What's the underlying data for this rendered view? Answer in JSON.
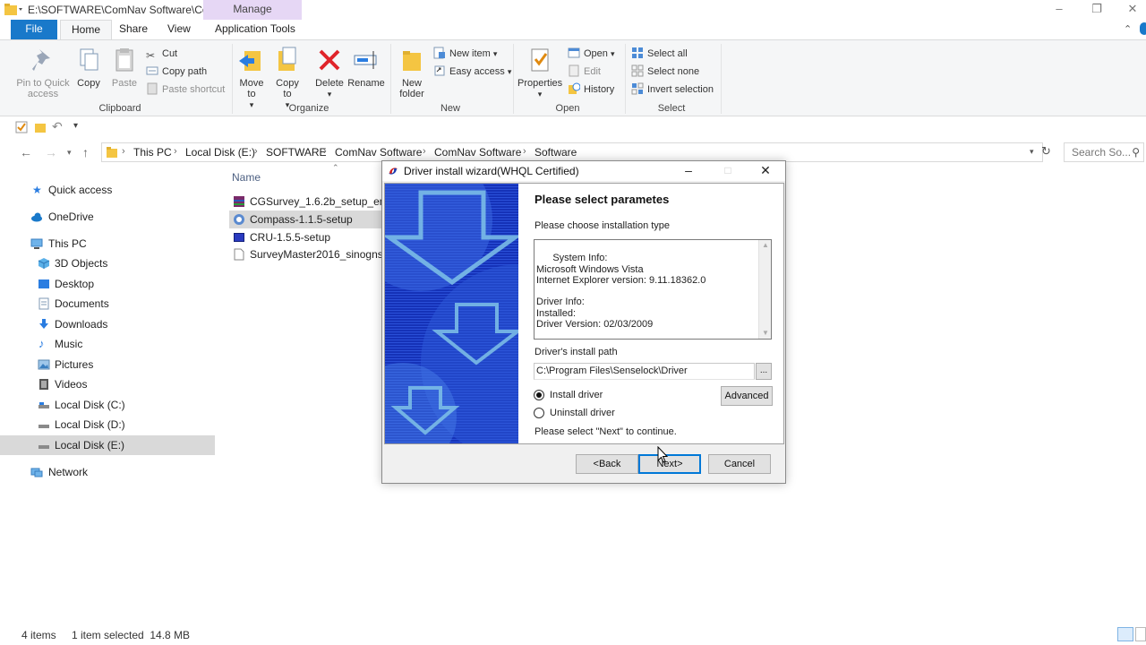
{
  "window": {
    "title": "E:\\SOFTWARE\\ComNav Software\\Co...",
    "manage_tab": "Manage"
  },
  "tabs": [
    "File",
    "Home",
    "Share",
    "View",
    "Application Tools"
  ],
  "ribbon": {
    "clipboard": {
      "label": "Clipboard",
      "pin": "Pin to Quick access",
      "copy": "Copy",
      "paste": "Paste",
      "cut": "Cut",
      "copy_path": "Copy path",
      "paste_shortcut": "Paste shortcut"
    },
    "organize": {
      "label": "Organize",
      "move_to": "Move to",
      "copy_to": "Copy to",
      "delete": "Delete",
      "rename": "Rename"
    },
    "new": {
      "label": "New",
      "new_folder": "New folder",
      "new_item": "New item",
      "easy_access": "Easy access"
    },
    "open": {
      "label": "Open",
      "properties": "Properties",
      "open": "Open",
      "edit": "Edit",
      "history": "History"
    },
    "select": {
      "label": "Select",
      "select_all": "Select all",
      "select_none": "Select none",
      "invert": "Invert selection"
    }
  },
  "breadcrumb": [
    "This PC",
    "Local Disk (E:)",
    "SOFTWARE",
    "ComNav Software",
    "ComNav Software",
    "Software"
  ],
  "search": {
    "placeholder": "Search So..."
  },
  "nav": [
    {
      "label": "Quick access",
      "icon": "star-icon"
    },
    {
      "label": "OneDrive",
      "icon": "cloud-icon"
    },
    {
      "label": "This PC",
      "icon": "monitor-icon"
    },
    {
      "label": "3D Objects",
      "icon": "cube-icon"
    },
    {
      "label": "Desktop",
      "icon": "desktop-icon"
    },
    {
      "label": "Documents",
      "icon": "document-icon"
    },
    {
      "label": "Downloads",
      "icon": "download-icon"
    },
    {
      "label": "Music",
      "icon": "music-icon"
    },
    {
      "label": "Pictures",
      "icon": "picture-icon"
    },
    {
      "label": "Videos",
      "icon": "video-icon"
    },
    {
      "label": "Local Disk (C:)",
      "icon": "drive-icon"
    },
    {
      "label": "Local Disk (D:)",
      "icon": "drive-icon"
    },
    {
      "label": "Local Disk (E:)",
      "icon": "drive-icon"
    },
    {
      "label": "Network",
      "icon": "network-icon"
    }
  ],
  "filelist": {
    "column_name": "Name",
    "files": [
      {
        "name": "CGSurvey_1.6.2b_setup_en",
        "icon": "archive-icon"
      },
      {
        "name": "Compass-1.1.5-setup",
        "icon": "setup-icon"
      },
      {
        "name": "CRU-1.5.5-setup",
        "icon": "setup-icon"
      },
      {
        "name": "SurveyMaster2016_sinognss-1",
        "icon": "file-icon"
      }
    ]
  },
  "status": {
    "items": "4 items",
    "selected": "1 item selected  14.8 MB"
  },
  "dialog": {
    "title": "Driver install wizard(WHQL Certified)",
    "heading": "Please select parametes",
    "choose_label": "Please choose installation type",
    "info_text": "System Info:\nMicrosoft Windows Vista\nInternet Explorer version: 9.11.18362.0\n\nDriver Info:\nInstalled:\nDriver Version: 02/03/2009",
    "path_label": "Driver's install path",
    "path_value": "C:\\Program Files\\Senselock\\Driver",
    "browse": "...",
    "install": "Install driver",
    "uninstall": "Uninstall driver",
    "advanced": "Advanced",
    "continue_text": "Please select \"Next\" to continue.",
    "back": "<Back",
    "next": "Next>",
    "cancel": "Cancel"
  },
  "colors": {
    "file_tab": "#1979ca",
    "manage_tab": "#e6d7f5",
    "banner_blue": "#1532b8",
    "selection": "#d9d9d9"
  }
}
